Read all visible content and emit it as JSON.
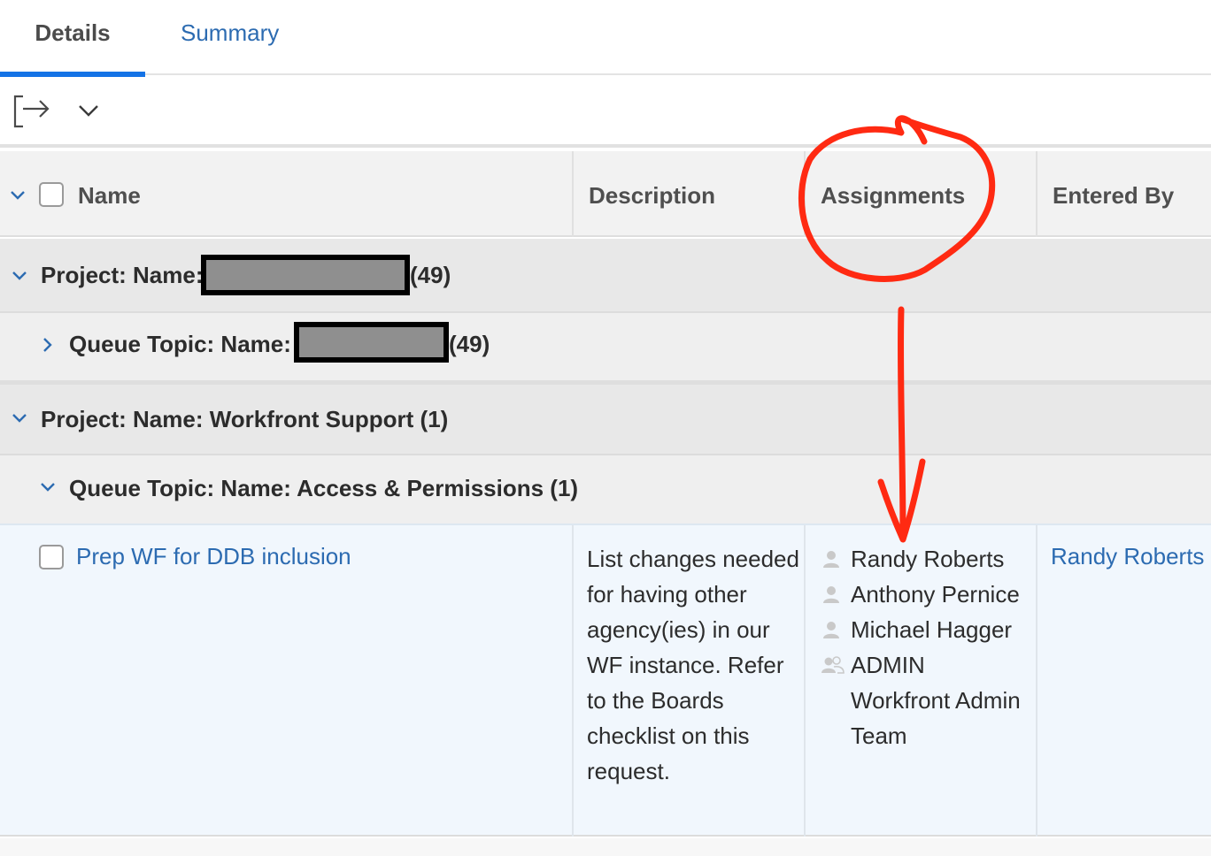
{
  "tabs": [
    {
      "label": "Details",
      "active": true
    },
    {
      "label": "Summary",
      "active": false
    }
  ],
  "toolbar": {
    "export_icon": "export-icon",
    "menu_icon": "chevron-down-icon"
  },
  "table": {
    "columns": {
      "name": "Name",
      "description": "Description",
      "assignments": "Assignments",
      "entered_by": "Entered By"
    },
    "groups": [
      {
        "project_prefix": "Project: Name:",
        "project_count": "(49)",
        "queue_prefix": "Queue Topic: Name:",
        "queue_count": "(49)"
      },
      {
        "project_label": "Project: Name: Workfront Support (1)",
        "queue_label": "Queue Topic: Name: Access & Permissions (1)"
      }
    ],
    "rows": [
      {
        "name": "Prep WF for DDB inclusion",
        "description": "List changes needed for having other agency(ies) in our WF instance. Refer to the Boards checklist on this request.",
        "assignments": [
          {
            "name": "Randy Roberts",
            "icon": "user-icon"
          },
          {
            "name": "Anthony Pernice",
            "icon": "user-icon"
          },
          {
            "name": "Michael Hagger",
            "icon": "user-icon"
          },
          {
            "name": "ADMIN Workfront Admin Team",
            "icon": "team-icon"
          }
        ],
        "entered_by": "Randy Roberts"
      }
    ]
  },
  "colors": {
    "accent": "#1473e6",
    "link": "#2c6bb1",
    "annotation": "#ff2a12",
    "redaction": "#8f8f8f"
  }
}
